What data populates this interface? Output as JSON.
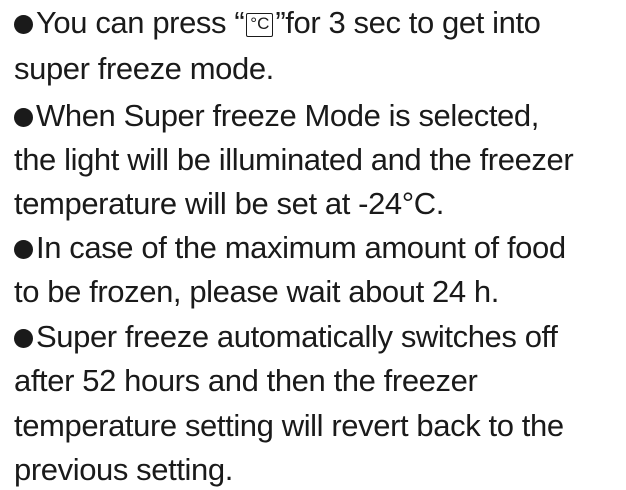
{
  "document": {
    "key_symbol": "°C",
    "bullet_1": {
      "before_key": "You can press “",
      "after_key": "”for 3 sec to get into",
      "line_2": "super freeze mode."
    },
    "bullet_2": {
      "line_1": "When Super freeze Mode is selected,",
      "line_2": "the light will be illuminated and the freezer",
      "line_3": "temperature will be set at -24°C."
    },
    "bullet_3": {
      "line_1": "In case of the maximum amount of food",
      "line_2": "to be frozen, please wait about 24 h."
    },
    "bullet_4": {
      "line_1": "Super freeze automatically switches off",
      "line_2": "after 52 hours and then the freezer",
      "line_3": "temperature setting will revert back to the",
      "line_4": "previous setting."
    }
  }
}
